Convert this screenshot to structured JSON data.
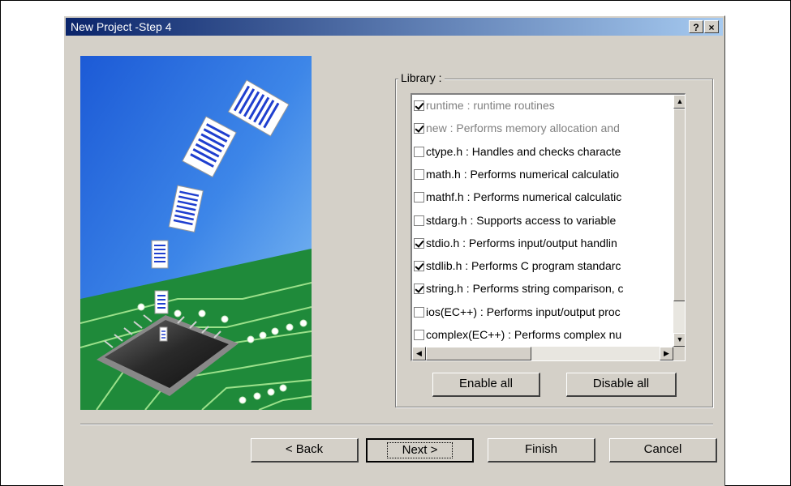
{
  "window": {
    "title": "New Project -Step 4",
    "help_button": "?",
    "close_button": "×"
  },
  "library": {
    "label": "Library :",
    "items": [
      {
        "text": "runtime : runtime routines",
        "checked": true,
        "disabled": true
      },
      {
        "text": "new : Performs memory allocation and",
        "checked": true,
        "disabled": true
      },
      {
        "text": "ctype.h : Handles and checks characte",
        "checked": false,
        "disabled": false
      },
      {
        "text": "math.h : Performs numerical calculatio",
        "checked": false,
        "disabled": false
      },
      {
        "text": "mathf.h : Performs numerical calculatic",
        "checked": false,
        "disabled": false
      },
      {
        "text": "stdarg.h : Supports access to variable",
        "checked": false,
        "disabled": false
      },
      {
        "text": "stdio.h : Performs input/output handlin",
        "checked": true,
        "disabled": false
      },
      {
        "text": "stdlib.h : Performs C program standarc",
        "checked": true,
        "disabled": false
      },
      {
        "text": "string.h : Performs string comparison, c",
        "checked": true,
        "disabled": false
      },
      {
        "text": "ios(EC++) : Performs input/output proc",
        "checked": false,
        "disabled": false
      },
      {
        "text": "complex(EC++) : Performs complex nu",
        "checked": false,
        "disabled": false
      }
    ],
    "scroll_up": "▲",
    "scroll_down": "▼",
    "scroll_left": "◀",
    "scroll_right": "▶",
    "enable_all": "Enable all",
    "disable_all": "Disable all"
  },
  "footer": {
    "back": "< Back",
    "next": "Next >",
    "finish": "Finish",
    "cancel": "Cancel"
  },
  "colors": {
    "titlebar_start": "#0a246a",
    "titlebar_end": "#a6caf0",
    "dialog_face": "#d4d0c8",
    "pcb_green": "#1f8a3a",
    "sky_blue": "#2f6fd8",
    "document_stripe": "#1f3fcf"
  }
}
